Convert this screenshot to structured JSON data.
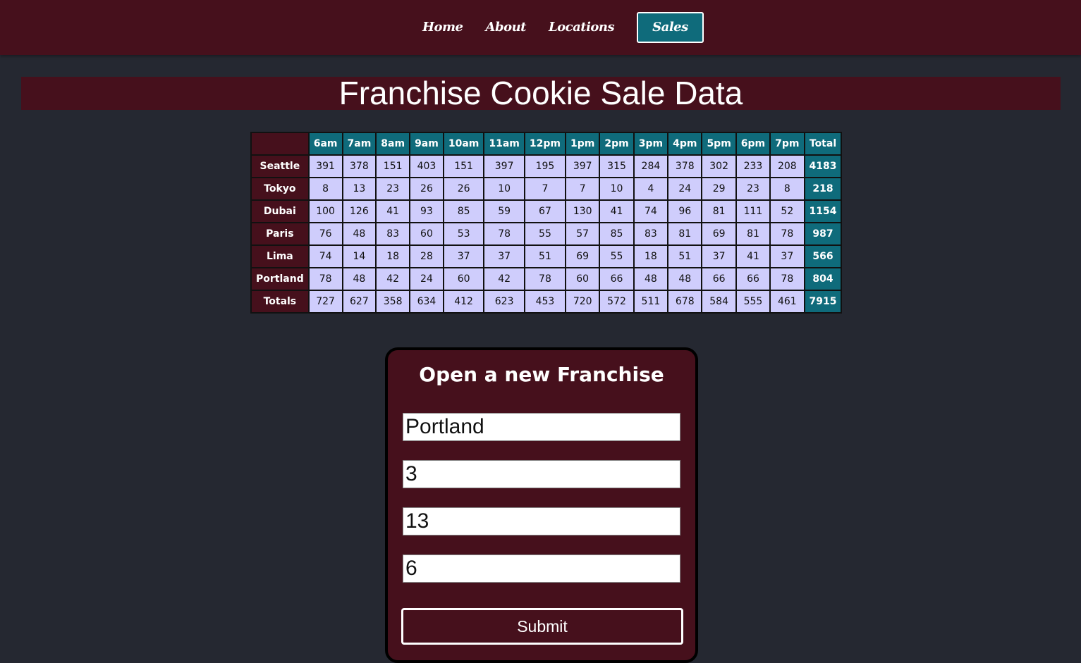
{
  "nav": {
    "items": [
      {
        "label": "Home",
        "active": false
      },
      {
        "label": "About",
        "active": false
      },
      {
        "label": "Locations",
        "active": false
      },
      {
        "label": "Sales",
        "active": true
      }
    ]
  },
  "page": {
    "title": "Franchise Cookie Sale Data"
  },
  "table": {
    "headers": [
      "6am",
      "7am",
      "8am",
      "9am",
      "10am",
      "11am",
      "12pm",
      "1pm",
      "2pm",
      "3pm",
      "4pm",
      "5pm",
      "6pm",
      "7pm",
      "Total"
    ],
    "rows": [
      {
        "location": "Seattle",
        "values": [
          "391",
          "378",
          "151",
          "403",
          "151",
          "397",
          "195",
          "397",
          "315",
          "284",
          "378",
          "302",
          "233",
          "208"
        ],
        "total": "4183"
      },
      {
        "location": "Tokyo",
        "values": [
          "8",
          "13",
          "23",
          "26",
          "26",
          "10",
          "7",
          "7",
          "10",
          "4",
          "24",
          "29",
          "23",
          "8"
        ],
        "total": "218"
      },
      {
        "location": "Dubai",
        "values": [
          "100",
          "126",
          "41",
          "93",
          "85",
          "59",
          "67",
          "130",
          "41",
          "74",
          "96",
          "81",
          "111",
          "52"
        ],
        "total": "1154"
      },
      {
        "location": "Paris",
        "values": [
          "76",
          "48",
          "83",
          "60",
          "53",
          "78",
          "55",
          "57",
          "85",
          "83",
          "81",
          "69",
          "81",
          "78"
        ],
        "total": "987"
      },
      {
        "location": "Lima",
        "values": [
          "74",
          "14",
          "18",
          "28",
          "37",
          "37",
          "51",
          "69",
          "55",
          "18",
          "51",
          "37",
          "41",
          "37"
        ],
        "total": "566"
      },
      {
        "location": "Portland",
        "values": [
          "78",
          "48",
          "42",
          "24",
          "60",
          "42",
          "78",
          "60",
          "66",
          "48",
          "48",
          "66",
          "66",
          "78"
        ],
        "total": "804"
      }
    ],
    "totals": {
      "label": "Totals",
      "values": [
        "727",
        "627",
        "358",
        "634",
        "412",
        "623",
        "453",
        "720",
        "572",
        "511",
        "678",
        "584",
        "555",
        "461"
      ],
      "grand_total": "7915"
    }
  },
  "form": {
    "title": "Open a new Franchise",
    "fields": [
      {
        "value": "Portland"
      },
      {
        "value": "3"
      },
      {
        "value": "13"
      },
      {
        "value": "6"
      }
    ],
    "submit_label": "Submit"
  },
  "colors": {
    "page_background": "#252831",
    "maroon": "#46101c",
    "teal": "#0f6b7b",
    "cell_lavender": "#cfcdfc"
  }
}
